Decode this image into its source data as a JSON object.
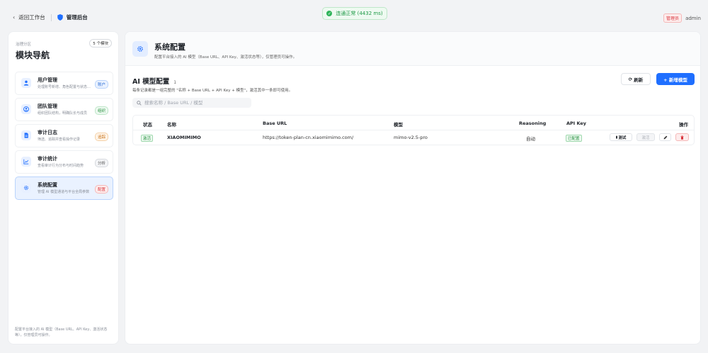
{
  "topbar": {
    "back_label": "返回工作台",
    "admin_title": "管理后台",
    "status_text": "连通正常 (4432 ms)",
    "role": "管理员",
    "username": "admin"
  },
  "sidebar": {
    "subtitle": "治理分区",
    "title": "模块导航",
    "count_badge": "5 个模块",
    "items": [
      {
        "name": "用户管理",
        "desc": "处理账号新增、角色配置与状态维护",
        "badge": "账户",
        "icon": "user-icon"
      },
      {
        "name": "团队管理",
        "desc": "组织团队结构，明确队长与成员",
        "badge": "组织",
        "icon": "team-icon"
      },
      {
        "name": "审计日志",
        "desc": "筛选、追踪并查看操作记录",
        "badge": "追踪",
        "icon": "document-icon"
      },
      {
        "name": "审计统计",
        "desc": "查看审计行为分布与时间趋势",
        "badge": "分析",
        "icon": "chart-icon"
      },
      {
        "name": "系统配置",
        "desc": "管理 AI 模型通道与平台全局参数",
        "badge": "配置",
        "icon": "gear-icon"
      }
    ],
    "footer": "配置平台接入的 AI 模型（Base URL、API Key、激活状态等），仅管理员可操作。"
  },
  "main": {
    "title": "系统配置",
    "desc": "配置平台接入的 AI 模型（Base URL、API Key、激活状态等），仅管理员可操作。",
    "section": {
      "title": "AI 模型配置",
      "count": "1",
      "desc": "每条记录都是一组完整的 \"名称 + Base URL + API Key + 模型\"，激活其中一条即可使用。",
      "refresh_label": "刷新",
      "add_label": "+ 新增模型",
      "search_placeholder": "搜索名称 / Base URL / 模型"
    },
    "table": {
      "headers": {
        "status": "状态",
        "name": "名称",
        "base_url": "Base URL",
        "model": "模型",
        "reasoning": "Reasoning",
        "api_key": "API Key",
        "actions": "操作"
      },
      "rows": [
        {
          "status": "激活",
          "name": "XIAOMIMIMO",
          "base_url": "https://token-plan-cn.xiaomimimo.com/",
          "model": "mimo-v2.5-pro",
          "reasoning": "自动",
          "api_key": "已配置",
          "test_label": "测试",
          "activate_label": "激活"
        }
      ]
    }
  },
  "colors": {
    "accent": "#1f6fff",
    "success": "#2fb45a",
    "danger": "#d9363e"
  }
}
